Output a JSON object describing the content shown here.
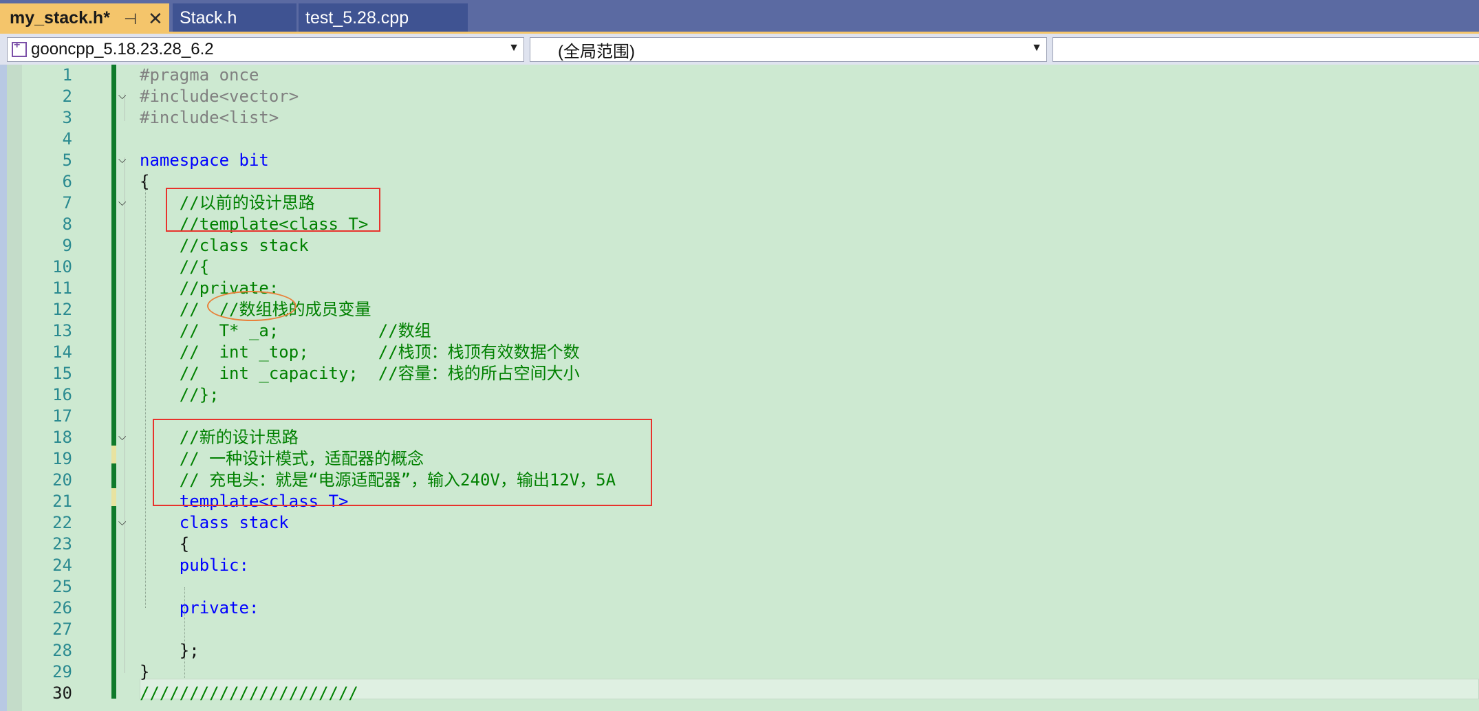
{
  "tabs": [
    {
      "label": "my_stack.h*",
      "active": true,
      "pin_icon": "pin-icon",
      "close_icon": "close-icon"
    },
    {
      "label": "Stack.h",
      "active": false
    },
    {
      "label": "test_5.28.cpp",
      "active": false
    }
  ],
  "navbar": {
    "project": "gooncpp_5.18.23.28_6.2",
    "scope": "(全局范围)",
    "member": ""
  },
  "colors": {
    "editor_bg": "#cde9d1",
    "tab_active": "#f4c56b",
    "tabbar": "#5b6aa2",
    "keyword": "#0000ff",
    "comment": "#008000",
    "type": "#2b91af",
    "string": "#a31515",
    "annotation_red": "#e8322c",
    "annotation_orange": "#e8813a"
  },
  "code": [
    {
      "n": "1",
      "t": "#pragma once"
    },
    {
      "n": "2",
      "t": "#include<vector>"
    },
    {
      "n": "3",
      "t": "#include<list>"
    },
    {
      "n": "4",
      "t": ""
    },
    {
      "n": "5",
      "t": "namespace bit"
    },
    {
      "n": "6",
      "t": "{"
    },
    {
      "n": "7",
      "t": "    //以前的设计思路"
    },
    {
      "n": "8",
      "t": "    //template<class T>"
    },
    {
      "n": "9",
      "t": "    //class stack"
    },
    {
      "n": "10",
      "t": "    //{"
    },
    {
      "n": "11",
      "t": "    //private:"
    },
    {
      "n": "12",
      "t": "    //  //数组栈的成员变量"
    },
    {
      "n": "13",
      "t": "    //  T* _a;          //数组"
    },
    {
      "n": "14",
      "t": "    //  int _top;       //栈顶：栈顶有效数据个数"
    },
    {
      "n": "15",
      "t": "    //  int _capacity;  //容量：栈的所占空间大小"
    },
    {
      "n": "16",
      "t": "    //};"
    },
    {
      "n": "17",
      "t": ""
    },
    {
      "n": "18",
      "t": "    //新的设计思路"
    },
    {
      "n": "19",
      "t": "    // 一种设计模式，适配器的概念"
    },
    {
      "n": "20",
      "t": "    // 充电头：就是“电源适配器”，输入240V，输出12V，5A"
    },
    {
      "n": "21",
      "t": "    template<class T>"
    },
    {
      "n": "22",
      "t": "    class stack"
    },
    {
      "n": "23",
      "t": "    {"
    },
    {
      "n": "24",
      "t": "    public:"
    },
    {
      "n": "25",
      "t": ""
    },
    {
      "n": "26",
      "t": "    private:"
    },
    {
      "n": "27",
      "t": ""
    },
    {
      "n": "28",
      "t": "    };"
    },
    {
      "n": "29",
      "t": "}"
    },
    {
      "n": "30",
      "t": "//////////////////////"
    }
  ]
}
